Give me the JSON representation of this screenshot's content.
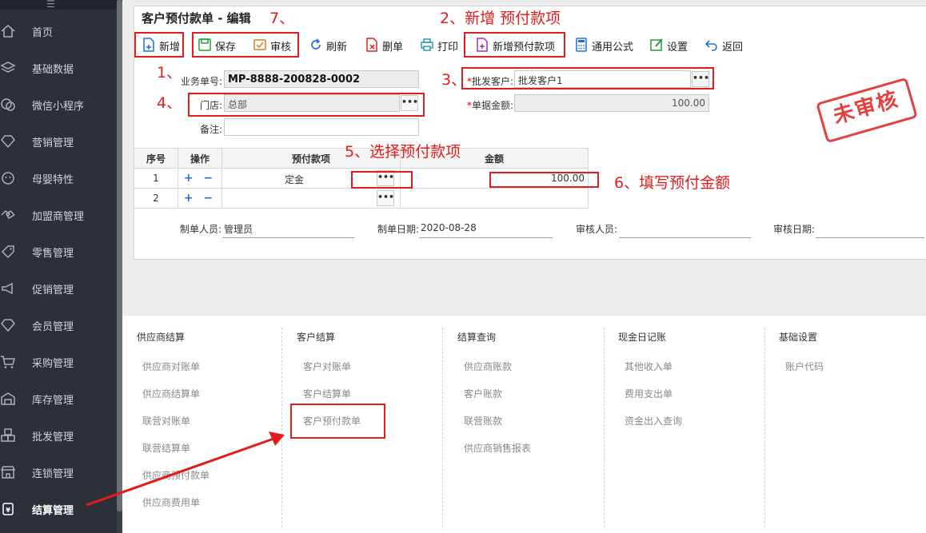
{
  "sidebar": {
    "items": [
      {
        "label": "首页",
        "icon": "home-icon"
      },
      {
        "label": "基础数据",
        "icon": "layers-icon"
      },
      {
        "label": "微信小程序",
        "icon": "wechat-icon"
      },
      {
        "label": "营销管理",
        "icon": "diamond-icon"
      },
      {
        "label": "母婴特性",
        "icon": "baby-icon"
      },
      {
        "label": "加盟商管理",
        "icon": "handshake-icon"
      },
      {
        "label": "零售管理",
        "icon": "tag-icon"
      },
      {
        "label": "促销管理",
        "icon": "megaphone-icon"
      },
      {
        "label": "会员管理",
        "icon": "member-diamond-icon"
      },
      {
        "label": "采购管理",
        "icon": "cart-icon"
      },
      {
        "label": "库存管理",
        "icon": "warehouse-icon"
      },
      {
        "label": "批发管理",
        "icon": "boxes-icon"
      },
      {
        "label": "连锁管理",
        "icon": "store-icon"
      },
      {
        "label": "结算管理",
        "icon": "settlement-icon"
      }
    ]
  },
  "form": {
    "title": "客户预付款单 - 编辑",
    "toolbar": {
      "new": "新增",
      "save": "保存",
      "audit": "审核",
      "refresh": "刷新",
      "delete": "删单",
      "print": "打印",
      "add_item": "新增预付款项",
      "formula": "通用公式",
      "settings": "设置",
      "back": "返回"
    },
    "fields": {
      "order_no_label": "业务单号:",
      "order_no": "MP-8888-200828-0002",
      "customer_label": "批发客户:",
      "customer": "批发客户1",
      "store_label": "门店:",
      "store": "总部",
      "amount_label": "单据金额:",
      "amount": "100.00",
      "remark_label": "备注:",
      "remark": ""
    },
    "status_stamp": "未审核",
    "grid": {
      "headers": [
        "序号",
        "操作",
        "预付款项",
        "金额"
      ],
      "rows": [
        {
          "no": "1",
          "op": "+ −",
          "item": "定金",
          "amount": "100.00"
        },
        {
          "no": "2",
          "op": "+ −",
          "item": "",
          "amount": ""
        }
      ]
    },
    "footer": {
      "creator_label": "制单人员:",
      "creator": "管理员",
      "create_date_label": "制单日期:",
      "create_date": "2020-08-28",
      "auditor_label": "审核人员:",
      "auditor": "",
      "audit_date_label": "审核日期:",
      "audit_date": ""
    }
  },
  "annotations": {
    "a1": "1、",
    "a2": "2、新增 预付款项",
    "a3": "3、",
    "a4": "4、",
    "a5": "5、选择预付款项",
    "a6": "6、填写预付金额",
    "a7": "7、"
  },
  "menu": {
    "columns": [
      {
        "title": "供应商结算",
        "items": [
          "供应商对账单",
          "供应商结算单",
          "联营对账单",
          "联营结算单",
          "供应商预付款单",
          "供应商费用单"
        ]
      },
      {
        "title": "客户结算",
        "items": [
          "客户对账单",
          "客户结算单",
          "客户预付款单"
        ]
      },
      {
        "title": "结算查询",
        "items": [
          "供应商账款",
          "客户账款",
          "联营账款",
          "供应商销售报表"
        ]
      },
      {
        "title": "现金日记账",
        "items": [
          "其他收入单",
          "费用支出单",
          "资金出入查询"
        ]
      },
      {
        "title": "基础设置",
        "items": [
          "账户代码"
        ]
      }
    ]
  },
  "colors": {
    "accent_red": "#e21c1c",
    "sidebar_bg": "#2c3038",
    "link_blue": "#1e6fd9"
  }
}
